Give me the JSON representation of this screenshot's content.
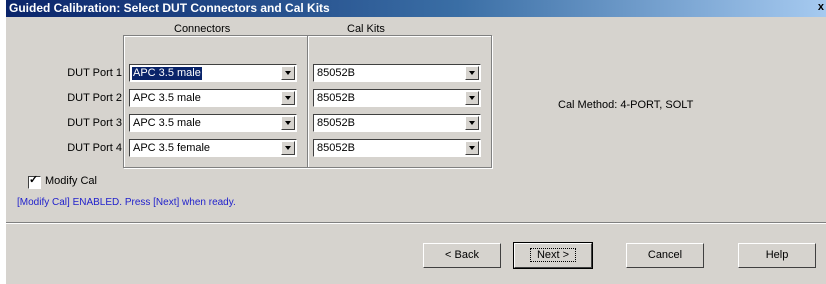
{
  "window": {
    "title": "Guided Calibration: Select DUT Connectors and Cal Kits",
    "close_glyph": "x"
  },
  "columns": {
    "connectors": "Connectors",
    "cal_kits": "Cal Kits"
  },
  "ports": [
    {
      "label": "DUT Port 1",
      "connector": "APC 3.5 male",
      "cal_kit": "85052B"
    },
    {
      "label": "DUT Port 2",
      "connector": "APC 3.5 male",
      "cal_kit": "85052B"
    },
    {
      "label": "DUT Port 3",
      "connector": "APC 3.5 male",
      "cal_kit": "85052B"
    },
    {
      "label": "DUT Port 4",
      "connector": "APC 3.5 female",
      "cal_kit": "85052B"
    }
  ],
  "cal_method": "Cal Method:  4-PORT, SOLT",
  "modify_cal": {
    "label": "Modify Cal",
    "checked": true
  },
  "status": "[Modify Cal] ENABLED.  Press [Next] when ready.",
  "buttons": {
    "back": "< Back",
    "next": "Next >",
    "cancel": "Cancel",
    "help": "Help"
  },
  "colors": {
    "title_start": "#0a246a",
    "title_end": "#a6caf0",
    "status_text": "#2222cc",
    "selection": "#0a246a"
  },
  "icons": {
    "dropdown": "chevron-down-icon",
    "checkbox": "check-icon"
  }
}
